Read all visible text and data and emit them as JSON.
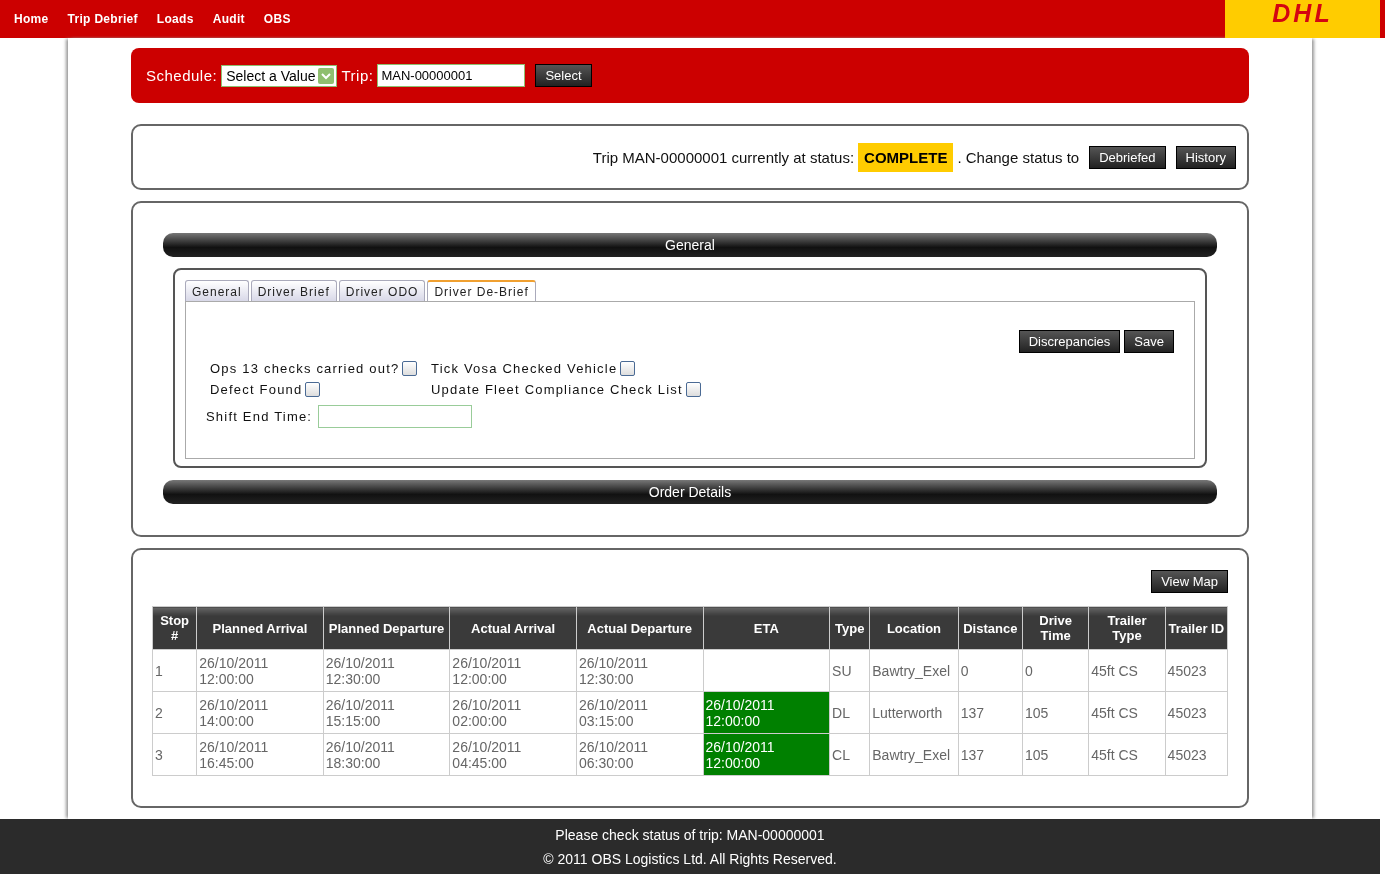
{
  "nav": {
    "items": [
      "Home",
      "Trip Debrief",
      "Loads",
      "Audit",
      "OBS"
    ],
    "logo": "DHL"
  },
  "schedule_bar": {
    "schedule_label": "Schedule:",
    "schedule_value": "Select a Value",
    "trip_label": "Trip:",
    "trip_value": "MAN-00000001",
    "button": "Select"
  },
  "status_panel": {
    "text": "Trip MAN-00000001 currently at status:",
    "status": "COMPLETE",
    "change_text": ". Change status to",
    "buttons": [
      "Debriefed",
      "History"
    ]
  },
  "general_section": {
    "title": "General",
    "tabs": [
      {
        "label": "General",
        "selected": false
      },
      {
        "label": "Driver Brief",
        "selected": false
      },
      {
        "label": "Driver ODO",
        "selected": false
      },
      {
        "label": "Driver De-Brief",
        "selected": true
      }
    ],
    "buttons": [
      "Discrepancies",
      "Save"
    ],
    "checks": [
      {
        "label": "Ops 13 checks carried out?",
        "checked": false
      },
      {
        "label": "Tick Vosa Checked Vehicle",
        "checked": false
      },
      {
        "label": "Defect Found",
        "checked": false
      },
      {
        "label": "Update Fleet Compliance Check List",
        "checked": false
      }
    ],
    "shift_end_label": "Shift End Time:"
  },
  "order_section": {
    "title": "Order Details"
  },
  "table": {
    "button": "View Map",
    "columns": [
      "Stop #",
      "Planned Arrival",
      "Planned Departure",
      "Actual Arrival",
      "Actual Departure",
      "ETA",
      "Type",
      "Location",
      "Distance",
      "Drive Time",
      "Trailer Type",
      "Trailer ID"
    ],
    "rows": [
      {
        "cells": [
          "1",
          "26/10/2011 12:00:00",
          "26/10/2011 12:30:00",
          "26/10/2011 12:00:00",
          "26/10/2011 12:30:00",
          null,
          "SU",
          "Bawtry_Exel",
          "0",
          "0",
          "45ft CS",
          "45023"
        ],
        "eta_highlighted": false
      },
      {
        "cells": [
          "2",
          "26/10/2011 14:00:00",
          "26/10/2011 15:15:00",
          "26/10/2011 02:00:00",
          "26/10/2011 03:15:00",
          "26/10/2011 12:00:00",
          "DL",
          "Lutterworth",
          "137",
          "105",
          "45ft CS",
          "45023"
        ],
        "eta_highlighted": true
      },
      {
        "cells": [
          "3",
          "26/10/2011 16:45:00",
          "26/10/2011 18:30:00",
          "26/10/2011 04:45:00",
          "26/10/2011 06:30:00",
          "26/10/2011 12:00:00",
          "CL",
          "Bawtry_Exel",
          "137",
          "105",
          "45ft CS",
          "45023"
        ],
        "eta_highlighted": true
      }
    ]
  },
  "footer": {
    "lines": [
      "Please check status of trip: MAN-00000001",
      "© 2011 OBS Logistics Ltd. All Rights Reserved."
    ]
  }
}
